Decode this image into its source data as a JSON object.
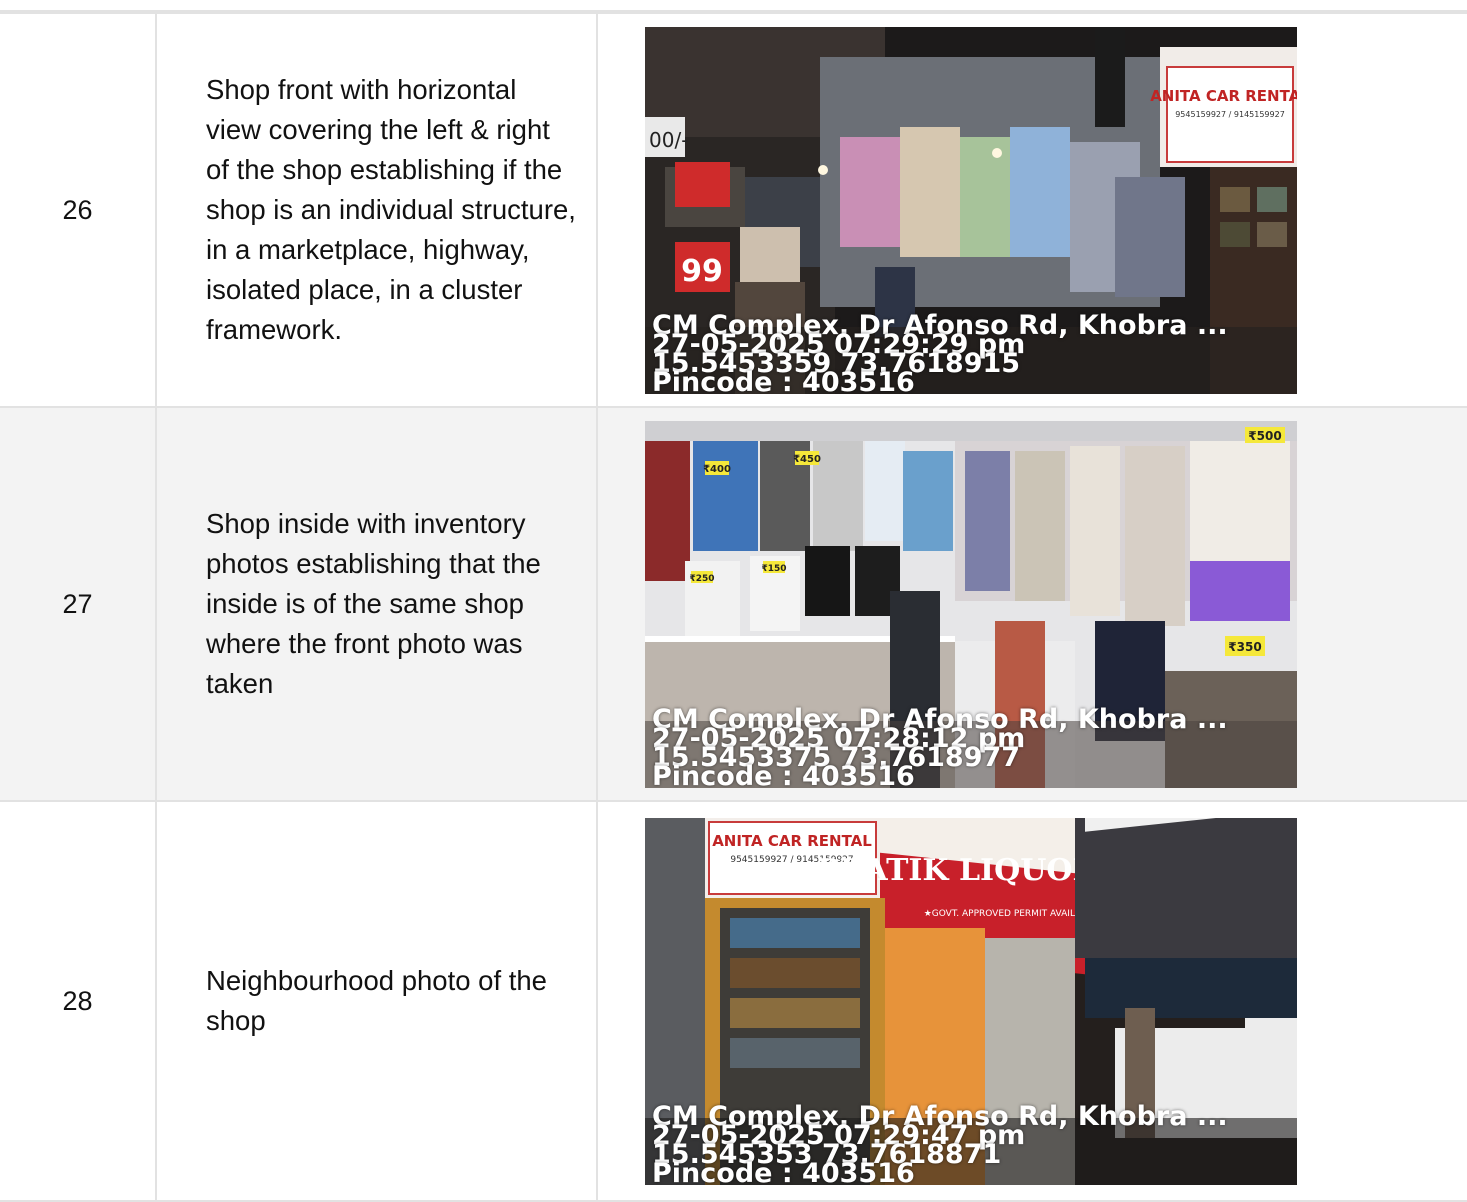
{
  "rows": [
    {
      "number": "26",
      "description": "Shop front with horizontal view covering the left & right of the shop establishing if the shop is an individual structure, in a marketplace, highway, isolated place, in a cluster framework.",
      "photo": {
        "address": "CM Complex, Dr Afonso Rd, Khobra ...",
        "datetime": "27-05-2025 07:29:29 pm",
        "coordinates": "15.5453359 73.7618915",
        "pincode": "Pincode : 403516",
        "signs": {
          "rental_title": "ANITA CAR RENTAL",
          "rental_phone": "9545159927 / 9145159927",
          "price_left": "00/-",
          "price_tag": "99"
        }
      }
    },
    {
      "number": "27",
      "description": "Shop inside with inventory photos establishing that the inside is of the same shop where the front photo was taken",
      "photo": {
        "address": "CM Complex, Dr Afonso Rd, Khobra ...",
        "datetime": "27-05-2025 07:28:12 pm",
        "coordinates": "15.5453375 73.7618977",
        "pincode": "Pincode : 403516",
        "signs": {
          "tag1": "₹400",
          "tag2": "₹450",
          "tag3": "₹500",
          "tag4": "₹250",
          "tag5": "₹150",
          "tag6": "₹350"
        }
      }
    },
    {
      "number": "28",
      "description": "Neighbourhood photo of the shop",
      "photo": {
        "address": "CM Complex, Dr Afonso Rd, Khobra ...",
        "datetime": "27-05-2025 07:29:47 pm",
        "coordinates": "15.545353 73.7618871",
        "pincode": "Pincode : 403516",
        "signs": {
          "rental_title": "ANITA CAR RENTAL",
          "rental_phone": "9545159927 / 9145159927",
          "liquor_title": "PRATIK LIQUOR HOUSE",
          "liquor_sub": "★GOVT. APPROVED PERMIT AVAILABLE★"
        }
      }
    }
  ],
  "colors": {
    "border": "#e2e2e2",
    "shaded_row": "#f3f3f3",
    "stamp_text": "#ffffff"
  }
}
